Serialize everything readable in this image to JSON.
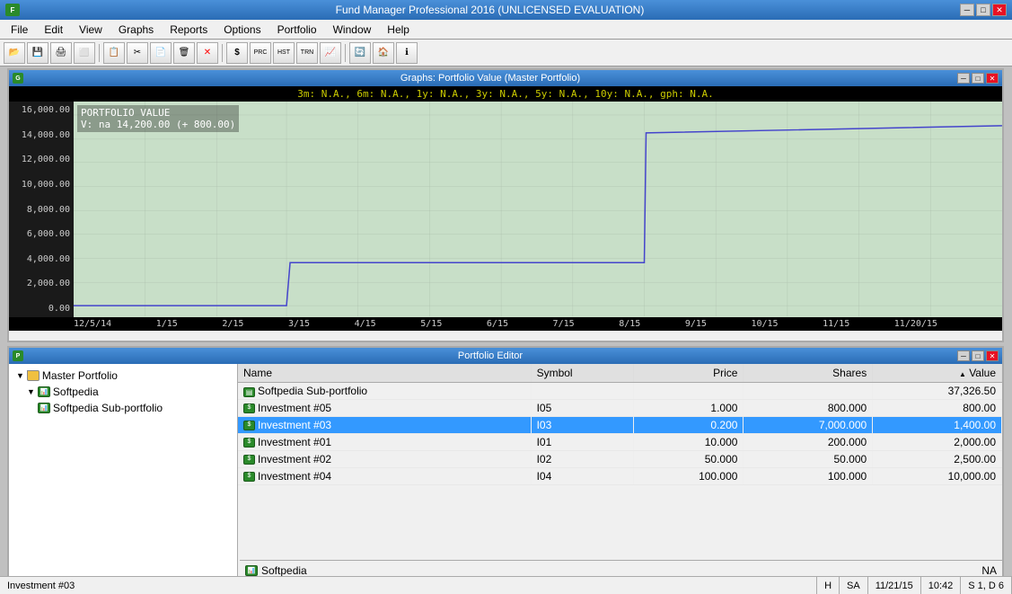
{
  "titlebar": {
    "title": "Fund Manager Professional 2016 (UNLICENSED EVALUATION)",
    "icon": "FM"
  },
  "menubar": {
    "items": [
      "File",
      "Edit",
      "View",
      "Graphs",
      "Reports",
      "Options",
      "Portfolio",
      "Window",
      "Help"
    ]
  },
  "toolbar": {
    "buttons": [
      "📂",
      "💾",
      "🖨",
      "📋",
      "✂",
      "📄",
      "🗑",
      "❌",
      "$",
      "📊",
      "HST",
      "TRN",
      "📈",
      "🔄",
      "🏠",
      "ℹ"
    ]
  },
  "graph_window": {
    "title": "Graphs: Portfolio Value (Master Portfolio)",
    "stats_bar": "3m: N.A.,   6m: N.A.,   1y: N.A.,   3y: N.A.,   5y: N.A.,   10y: N.A.,   gph: N.A.",
    "portfolio_label": "PORTFOLIO VALUE",
    "value_label": "V: na 14,200.00 (+ 800.00)",
    "y_labels": [
      "16,000.00",
      "14,000.00",
      "12,000.00",
      "10,000.00",
      "8,000.00",
      "6,000.00",
      "4,000.00",
      "2,000.00",
      "0.00"
    ],
    "x_labels": [
      "12/5/14",
      "1/15",
      "2/15",
      "3/15",
      "4/15",
      "5/15",
      "6/15",
      "7/15",
      "8/15",
      "9/15",
      "10/15",
      "11/15",
      "11/20/15"
    ]
  },
  "portfolio_window": {
    "title": "Portfolio Editor",
    "tree": {
      "items": [
        {
          "label": "Master Portfolio",
          "level": 1,
          "type": "folder",
          "expanded": true
        },
        {
          "label": "Softpedia",
          "level": 2,
          "type": "folder",
          "expanded": true
        },
        {
          "label": "Softpedia Sub-portfolio",
          "level": 3,
          "type": "folder"
        }
      ]
    },
    "table": {
      "columns": [
        {
          "label": "Name",
          "align": "left"
        },
        {
          "label": "Symbol",
          "align": "left"
        },
        {
          "label": "Price",
          "align": "right"
        },
        {
          "label": "Shares",
          "align": "right"
        },
        {
          "label": "▲ Value",
          "align": "right"
        }
      ],
      "rows": [
        {
          "name": "Softpedia Sub-portfolio",
          "symbol": "",
          "price": "",
          "shares": "",
          "value": "37,326.50",
          "type": "folder",
          "selected": false
        },
        {
          "name": "Investment #05",
          "symbol": "I05",
          "price": "1.000",
          "shares": "800.000",
          "value": "800.00",
          "type": "stock",
          "selected": false
        },
        {
          "name": "Investment #03",
          "symbol": "I03",
          "price": "0.200",
          "shares": "7,000.000",
          "value": "1,400.00",
          "type": "stock",
          "selected": true
        },
        {
          "name": "Investment #01",
          "symbol": "I01",
          "price": "10.000",
          "shares": "200.000",
          "value": "2,000.00",
          "type": "stock",
          "selected": false
        },
        {
          "name": "Investment #02",
          "symbol": "I02",
          "price": "50.000",
          "shares": "50.000",
          "value": "2,500.00",
          "type": "stock",
          "selected": false
        },
        {
          "name": "Investment #04",
          "symbol": "I04",
          "price": "100.000",
          "shares": "100.000",
          "value": "10,000.00",
          "type": "stock",
          "selected": false
        }
      ]
    },
    "footer": {
      "icon_label": "Softpedia",
      "value": "NA"
    }
  },
  "statusbar": {
    "selected": "Investment #03",
    "h_label": "H",
    "sa_label": "SA",
    "date": "11/21/15",
    "time": "10:42",
    "s_label": "S 1, D 6"
  }
}
